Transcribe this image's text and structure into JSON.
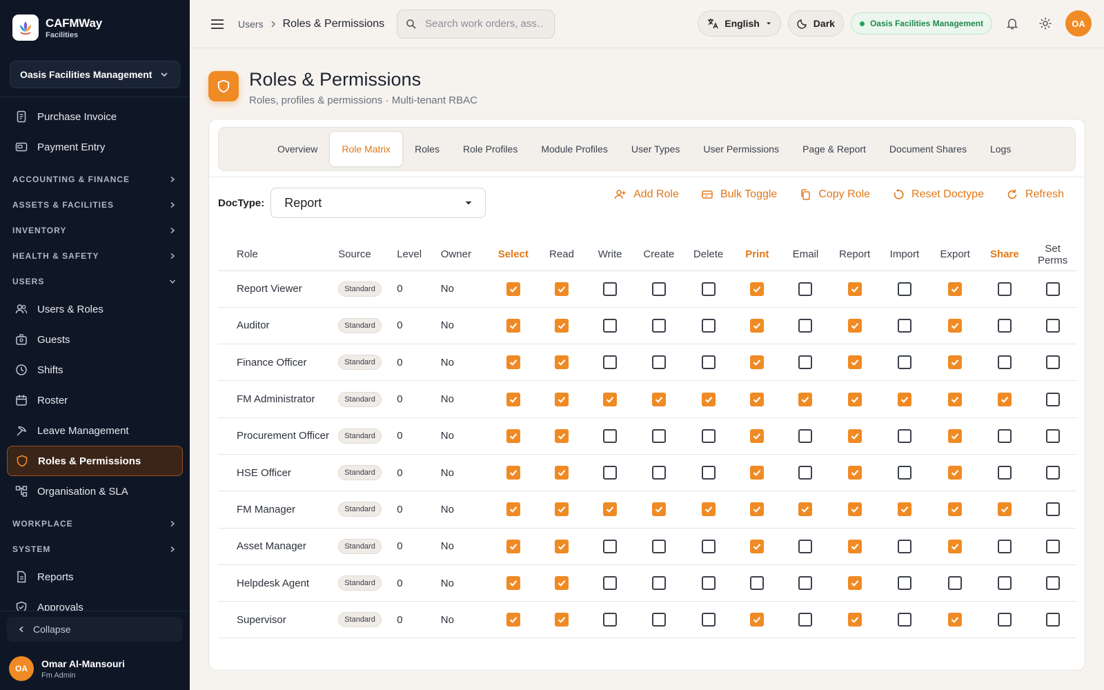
{
  "brand": {
    "name": "CAFMWay",
    "subtitle": "Facilities",
    "logo_icon": "lotus-logo-icon"
  },
  "sidebar": {
    "tenant": "Oasis Facilities Management",
    "top_items": [
      {
        "label": "Purchase Invoice",
        "icon": "invoice-icon"
      },
      {
        "label": "Payment Entry",
        "icon": "payment-icon"
      }
    ],
    "sections_a": [
      {
        "label": "ACCOUNTING & FINANCE"
      },
      {
        "label": "ASSETS & FACILITIES"
      },
      {
        "label": "INVENTORY"
      },
      {
        "label": "HEALTH & SAFETY"
      },
      {
        "label": "USERS"
      }
    ],
    "users_items": [
      {
        "label": "Users & Roles",
        "icon": "users-icon"
      },
      {
        "label": "Guests",
        "icon": "guests-icon"
      },
      {
        "label": "Shifts",
        "icon": "clock-icon"
      },
      {
        "label": "Roster",
        "icon": "calendar-icon"
      },
      {
        "label": "Leave Management",
        "icon": "leave-icon"
      },
      {
        "label": "Roles & Permissions",
        "icon": "shield-icon",
        "active": true
      },
      {
        "label": "Organisation & SLA",
        "icon": "org-icon"
      }
    ],
    "sections_b": [
      {
        "label": "WORKPLACE"
      },
      {
        "label": "SYSTEM"
      }
    ],
    "bottom_items": [
      {
        "label": "Reports",
        "icon": "report-icon"
      },
      {
        "label": "Approvals",
        "icon": "approval-icon"
      }
    ],
    "collapse_label": "Collapse",
    "user": {
      "initials": "OA",
      "name": "Omar Al-Mansouri",
      "role": "Fm Admin"
    }
  },
  "topbar": {
    "breadcrumb_parent": "Users",
    "breadcrumb_current": "Roles & Permissions",
    "search_placeholder": "Search work orders, ass…",
    "language": "English",
    "theme": "Dark",
    "tenant": "Oasis Facilities Management",
    "user_initials": "OA"
  },
  "page": {
    "title": "Roles & Permissions",
    "subtitle": "Roles, profiles & permissions · Multi-tenant RBAC"
  },
  "tabs": [
    "Overview",
    "Role Matrix",
    "Roles",
    "Role Profiles",
    "Module Profiles",
    "User Types",
    "User Permissions",
    "Page & Report",
    "Document Shares",
    "Logs"
  ],
  "active_tab": "Role Matrix",
  "toolbar": {
    "doctype_label": "DocType:",
    "doctype_value": "Report",
    "actions": [
      {
        "label": "Add Role",
        "icon": "add-user-icon"
      },
      {
        "label": "Bulk Toggle",
        "icon": "toggle-icon"
      },
      {
        "label": "Copy Role",
        "icon": "copy-icon"
      },
      {
        "label": "Reset Doctype",
        "icon": "reset-icon"
      },
      {
        "label": "Refresh",
        "icon": "refresh-icon"
      }
    ]
  },
  "matrix": {
    "columns": [
      "Role",
      "Source",
      "Level",
      "Owner",
      "Select",
      "Read",
      "Write",
      "Create",
      "Delete",
      "Print",
      "Email",
      "Report",
      "Import",
      "Export",
      "Share",
      "Set Perms"
    ],
    "highlighted_columns": [
      "Select",
      "Print",
      "Share"
    ],
    "rows": [
      {
        "role": "Report Viewer",
        "source": "Standard",
        "level": "0",
        "owner": "No",
        "perms": [
          1,
          1,
          0,
          0,
          0,
          1,
          0,
          1,
          0,
          1,
          0,
          0
        ]
      },
      {
        "role": "Auditor",
        "source": "Standard",
        "level": "0",
        "owner": "No",
        "perms": [
          1,
          1,
          0,
          0,
          0,
          1,
          0,
          1,
          0,
          1,
          0,
          0
        ]
      },
      {
        "role": "Finance Officer",
        "source": "Standard",
        "level": "0",
        "owner": "No",
        "perms": [
          1,
          1,
          0,
          0,
          0,
          1,
          0,
          1,
          0,
          1,
          0,
          0
        ]
      },
      {
        "role": "FM Administrator",
        "source": "Standard",
        "level": "0",
        "owner": "No",
        "perms": [
          1,
          1,
          1,
          1,
          1,
          1,
          1,
          1,
          1,
          1,
          1,
          0
        ]
      },
      {
        "role": "Procurement Officer",
        "source": "Standard",
        "level": "0",
        "owner": "No",
        "perms": [
          1,
          1,
          0,
          0,
          0,
          1,
          0,
          1,
          0,
          1,
          0,
          0
        ]
      },
      {
        "role": "HSE Officer",
        "source": "Standard",
        "level": "0",
        "owner": "No",
        "perms": [
          1,
          1,
          0,
          0,
          0,
          1,
          0,
          1,
          0,
          1,
          0,
          0
        ]
      },
      {
        "role": "FM Manager",
        "source": "Standard",
        "level": "0",
        "owner": "No",
        "perms": [
          1,
          1,
          1,
          1,
          1,
          1,
          1,
          1,
          1,
          1,
          1,
          0
        ]
      },
      {
        "role": "Asset Manager",
        "source": "Standard",
        "level": "0",
        "owner": "No",
        "perms": [
          1,
          1,
          0,
          0,
          0,
          1,
          0,
          1,
          0,
          1,
          0,
          0
        ]
      },
      {
        "role": "Helpdesk Agent",
        "source": "Standard",
        "level": "0",
        "owner": "No",
        "perms": [
          1,
          1,
          0,
          0,
          0,
          0,
          0,
          1,
          0,
          0,
          0,
          0
        ]
      },
      {
        "role": "Supervisor",
        "source": "Standard",
        "level": "0",
        "owner": "No",
        "perms": [
          1,
          1,
          0,
          0,
          0,
          1,
          0,
          1,
          0,
          1,
          0,
          0
        ]
      }
    ]
  },
  "colors": {
    "accent": "#f08a24",
    "sidebar_bg": "#0f1726",
    "success": "#22a55b"
  }
}
